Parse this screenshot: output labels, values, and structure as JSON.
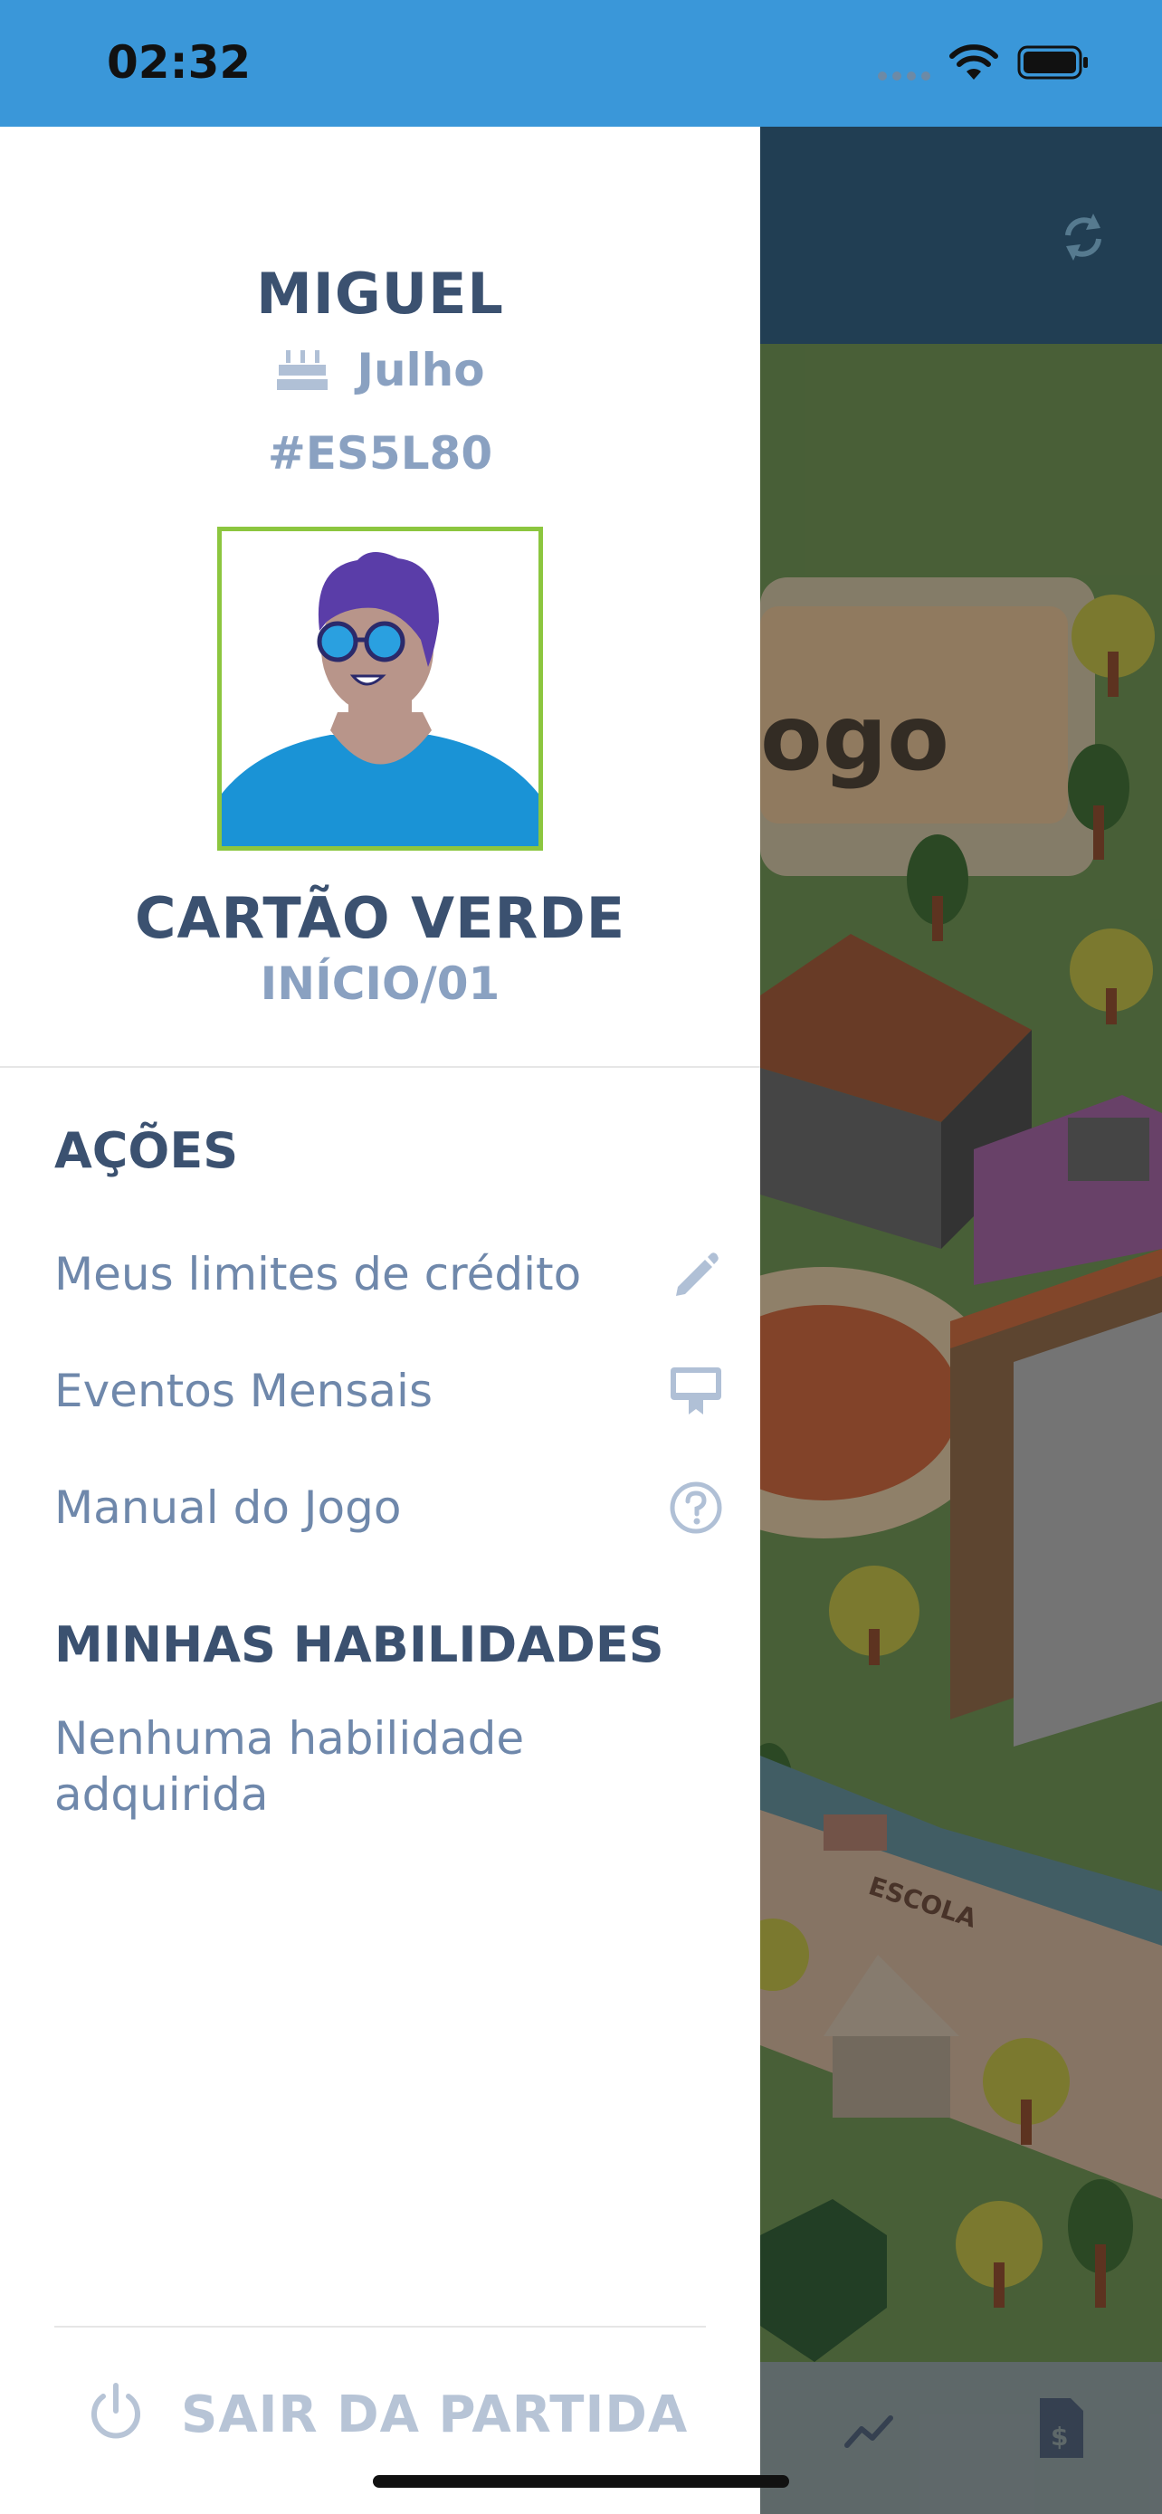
{
  "status_bar": {
    "time": "02:32"
  },
  "drawer": {
    "player_name": "MIGUEL",
    "birth_month": "Julho",
    "player_code": "#ES5L80",
    "card_title": "CARTÃO VERDE",
    "card_subtitle": "INÍCIO/01",
    "actions_title": "AÇÕES",
    "actions": [
      {
        "label": "Meus limites de crédito",
        "icon": "pencil-icon"
      },
      {
        "label": "Eventos Mensais",
        "icon": "card-event-icon"
      },
      {
        "label": "Manual do Jogo",
        "icon": "help-circle-icon"
      }
    ],
    "skills_title": "MINHAS HABILIDADES",
    "skills_empty": "Nenhuma habilidade adquirida",
    "logout_label": "SAIR DA PARTIDA"
  },
  "background": {
    "sign_fragment": "ogo",
    "school_sign": "ESCOLA"
  },
  "colors": {
    "status_bar": "#3a97d9",
    "title_text": "#3b5170",
    "muted_text": "#8aa1c1",
    "avatar_border": "#8cc63f"
  }
}
